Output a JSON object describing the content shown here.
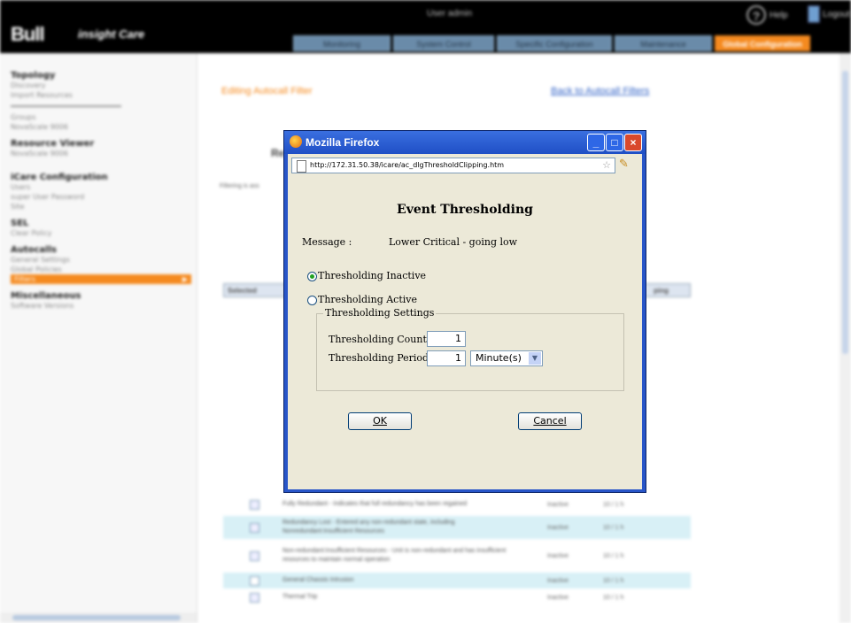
{
  "header": {
    "logo": "Bull",
    "app_name": "insight Care",
    "user": "User admin",
    "help_label": "Help",
    "logout_label": "Logout",
    "tabs": [
      {
        "label": "Monitoring"
      },
      {
        "label": "System Control"
      },
      {
        "label": "Specific Configuration"
      },
      {
        "label": "Maintenance"
      },
      {
        "label": "Global Configuration"
      }
    ]
  },
  "sidebar": {
    "topology": {
      "title": "Topology",
      "items": [
        "Discovery",
        "Import Resources"
      ]
    },
    "groups": {
      "items": [
        "Groups",
        "NovaScale 9006"
      ]
    },
    "resource_viewer": {
      "title": "Resource Viewer",
      "items": [
        "NovaScale 9006"
      ]
    },
    "icare_config": {
      "title": "iCare Configuration",
      "items": [
        "Users",
        "super User Password",
        "Site"
      ]
    },
    "sel": {
      "title": "SEL",
      "items": [
        "Clear Policy"
      ]
    },
    "autocalls": {
      "title": "Autocalls",
      "items": [
        "General Settings",
        "Global Policies",
        "Filters"
      ]
    },
    "misc": {
      "title": "Miscellaneous",
      "items": [
        "Software Versions"
      ]
    }
  },
  "main": {
    "editing_title": "Editing Autocall Filter",
    "back_link": "Back to Autocall Filters",
    "heading_fragment": "Re",
    "filtering_text": "Filtering is ass",
    "table_header_selected": "Selected",
    "table_header_clipping": "ping",
    "rows": [
      {
        "desc": "Fully Redundant - Indicates that full redundancy has been regained",
        "state": "Inactive",
        "clip": "10 / 1 h"
      },
      {
        "desc": "Redundancy Lost - Entered any non-redundant state, including Nonredundant:Insufficient Resources",
        "state": "Inactive",
        "clip": "10 / 1 h"
      },
      {
        "desc": "Non-redundant:Insufficient Resources - Unit is non-redundant and has insufficient resources to maintain normal operation",
        "state": "Inactive",
        "clip": "10 / 1 h"
      },
      {
        "desc": "General Chassis Intrusion",
        "state": "Inactive",
        "clip": "10 / 1 h"
      },
      {
        "desc": "Thermal Trip",
        "state": "Inactive",
        "clip": "10 / 1 h"
      }
    ]
  },
  "popup": {
    "window_title": "Mozilla Firefox",
    "url": "http://172.31.50.38/icare/ac_dlgThresholdClipping.htm",
    "dialog_title": "Event Thresholding",
    "message_label": "Message :",
    "message_value": "Lower Critical - going low",
    "radio_inactive": "Thresholding Inactive",
    "radio_active": "Thresholding Active",
    "selected_radio": "inactive",
    "settings_legend": "Thresholding Settings",
    "count_label": "Thresholding Count",
    "count_value": "1",
    "period_label": "Thresholding Period",
    "period_value": "1",
    "period_unit": "Minute(s)",
    "ok_label": "OK",
    "cancel_label": "Cancel"
  },
  "colors": {
    "accent_orange": "#f58a1f",
    "xp_blue": "#2855c8",
    "dialog_bg": "#ece9d8"
  }
}
